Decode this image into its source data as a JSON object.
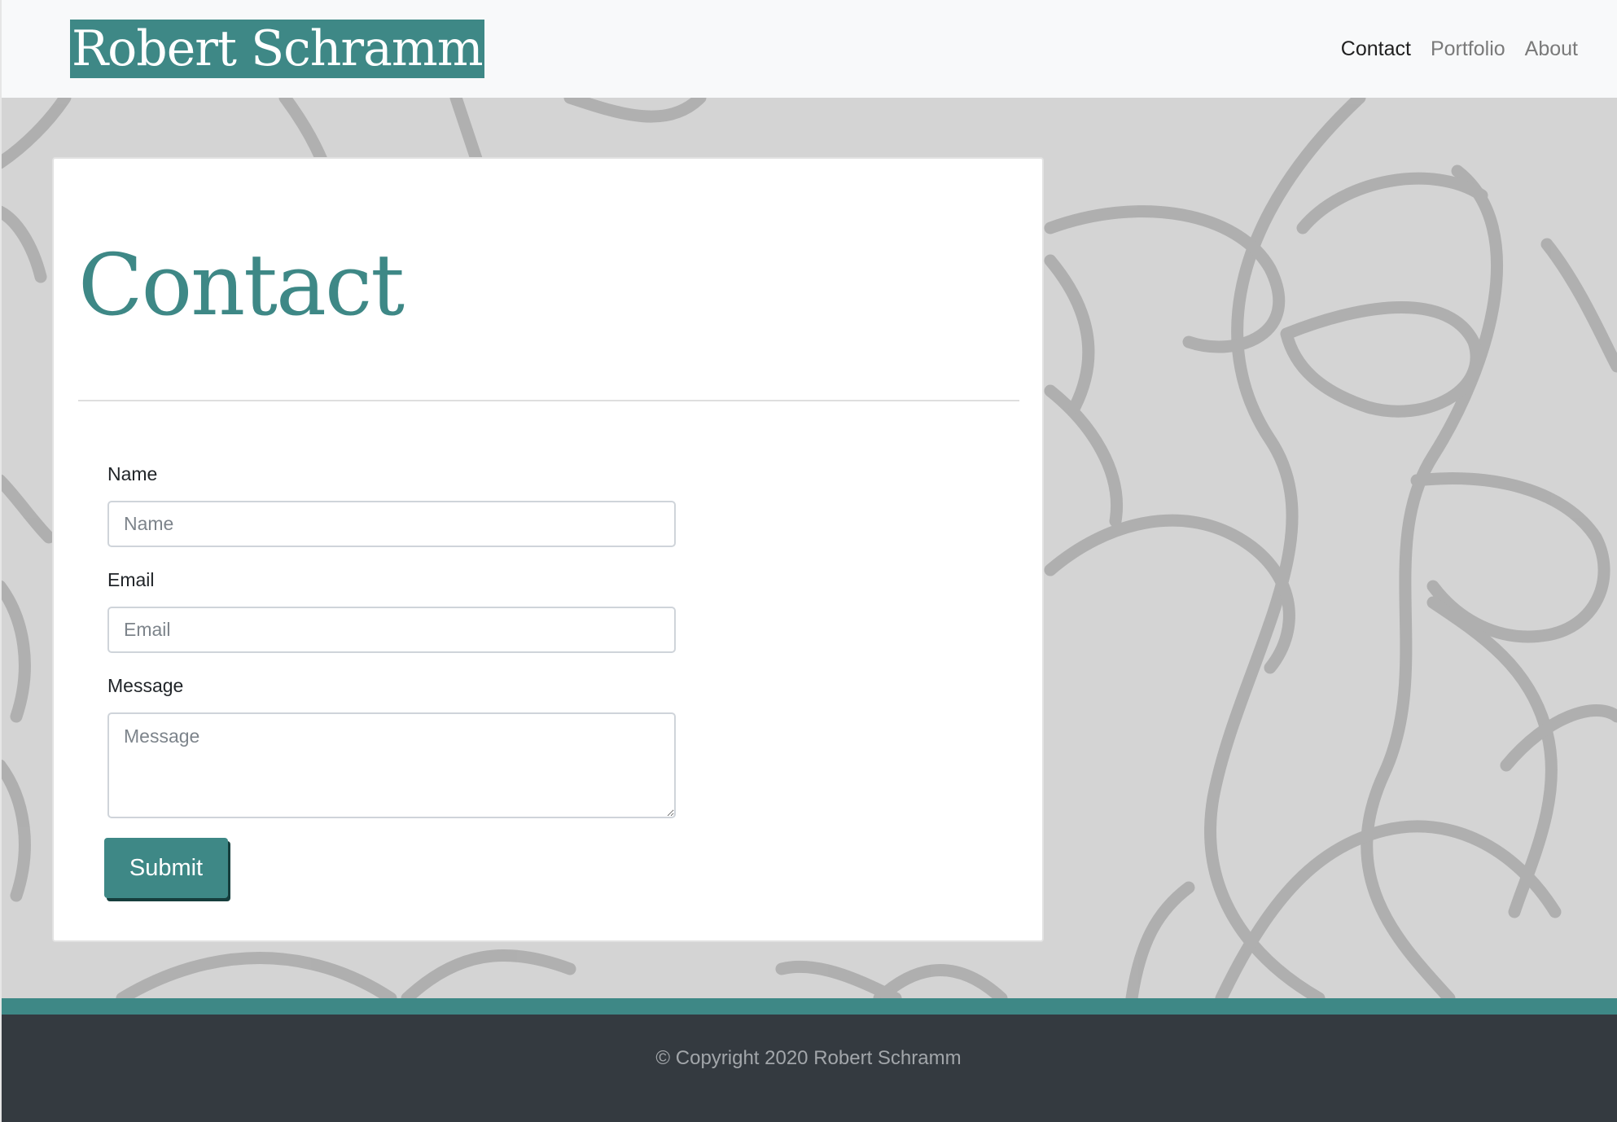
{
  "navbar": {
    "brand": "Robert Schramm",
    "links": [
      {
        "label": "Contact",
        "active": true
      },
      {
        "label": "Portfolio",
        "active": false
      },
      {
        "label": "About",
        "active": false
      }
    ]
  },
  "main": {
    "title": "Contact",
    "form": {
      "name_label": "Name",
      "name_placeholder": "Name",
      "name_value": "",
      "email_label": "Email",
      "email_placeholder": "Email",
      "email_value": "",
      "message_label": "Message",
      "message_placeholder": "Message",
      "message_value": "",
      "submit_label": "Submit"
    }
  },
  "footer": {
    "copyright": "© Copyright 2020 Robert Schramm"
  },
  "colors": {
    "accent": "#3e8886",
    "navbar_bg": "#f8f9fa",
    "footer_bg": "#343a40",
    "page_bg": "#d4d4d4"
  }
}
